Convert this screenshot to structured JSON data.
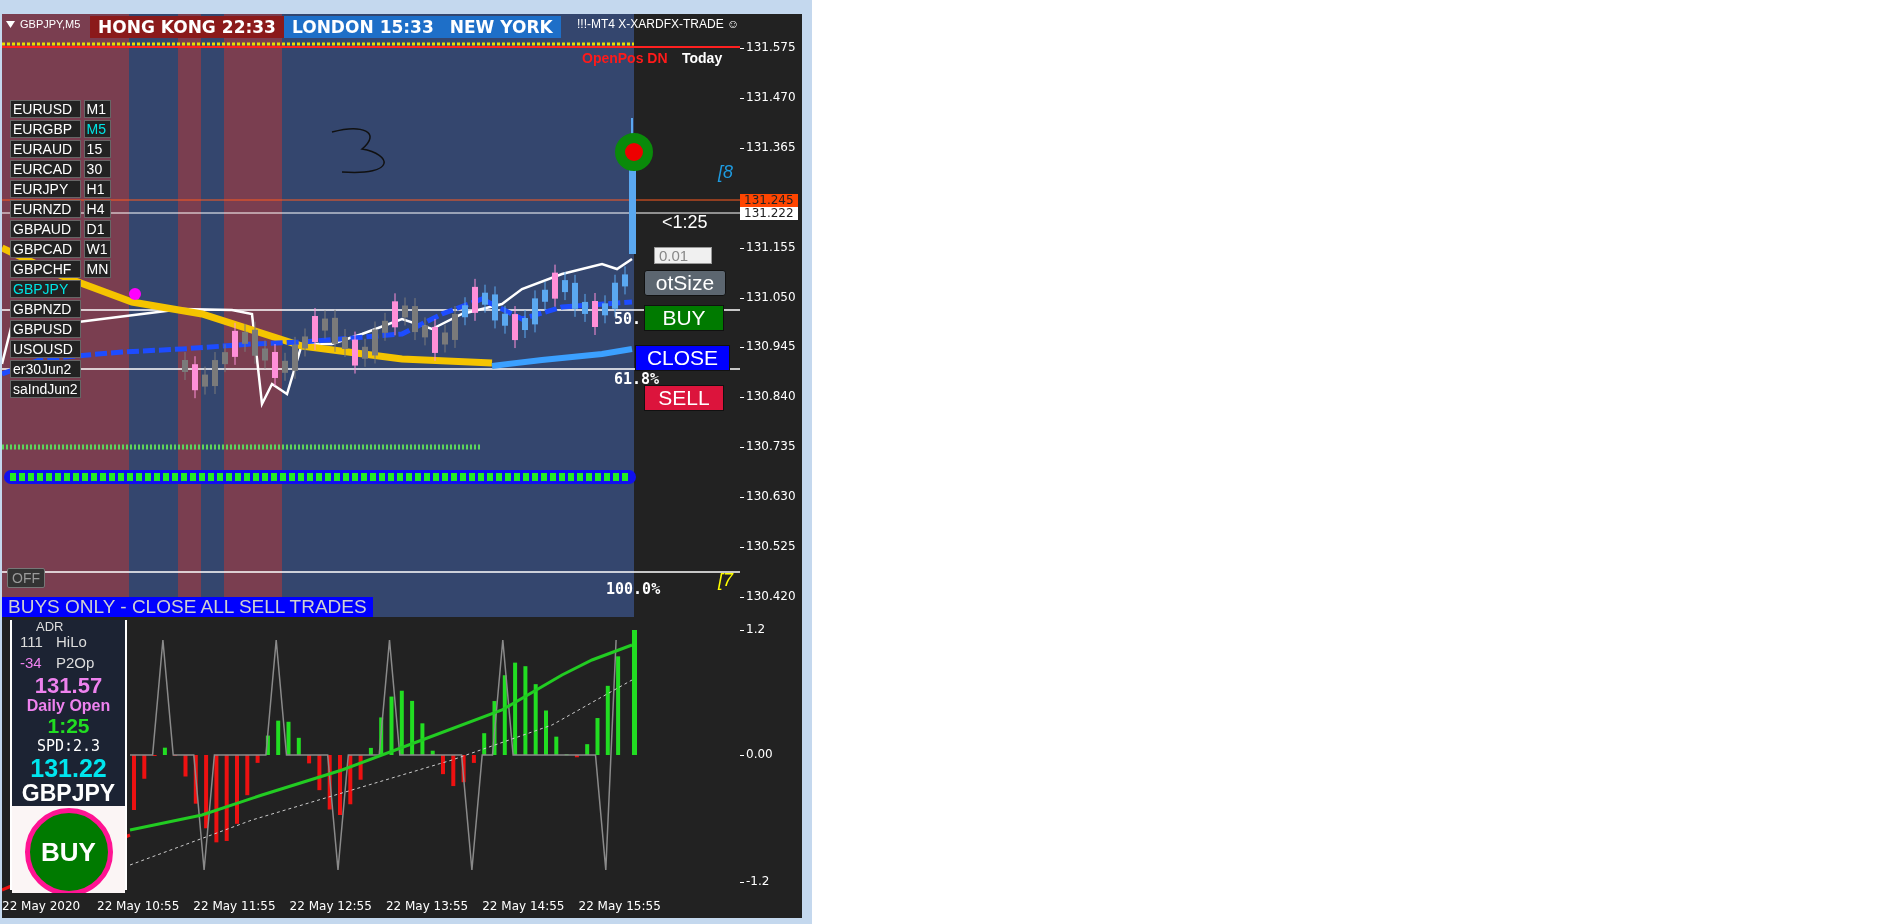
{
  "chart_tab": {
    "label": "GBPJPY,M5"
  },
  "sessions": [
    {
      "name": "HONG KONG",
      "time": "22:33",
      "color": "#8b1a1a"
    },
    {
      "name": "LONDON",
      "time": "15:33",
      "color": "#1e6fc8"
    },
    {
      "name": "NEW YORK",
      "color": "#1e6fc8"
    }
  ],
  "ea_title": "!!!-MT4 X-XARDFX-TRADE ☺",
  "open_pos_label": "OpenPos DN",
  "today_label": "Today",
  "symbols": [
    {
      "symbol": "EURUSD",
      "timeframe": "M1",
      "symbol_selected": false,
      "timeframe_selected": false
    },
    {
      "symbol": "EURGBP",
      "timeframe": "M5",
      "symbol_selected": false,
      "timeframe_selected": true
    },
    {
      "symbol": "EURAUD",
      "timeframe": "15",
      "symbol_selected": false,
      "timeframe_selected": false
    },
    {
      "symbol": "EURCAD",
      "timeframe": "30",
      "symbol_selected": false,
      "timeframe_selected": false
    },
    {
      "symbol": "EURJPY",
      "timeframe": "H1",
      "symbol_selected": false,
      "timeframe_selected": false
    },
    {
      "symbol": "EURNZD",
      "timeframe": "H4",
      "symbol_selected": false,
      "timeframe_selected": false
    },
    {
      "symbol": "GBPAUD",
      "timeframe": "D1",
      "symbol_selected": false,
      "timeframe_selected": false
    },
    {
      "symbol": "GBPCAD",
      "timeframe": "W1",
      "symbol_selected": false,
      "timeframe_selected": false
    },
    {
      "symbol": "GBPCHF",
      "timeframe": "MN",
      "symbol_selected": false,
      "timeframe_selected": false
    },
    {
      "symbol": "GBPJPY",
      "symbol_selected": true
    },
    {
      "symbol": "GBPNZD",
      "symbol_selected": false
    },
    {
      "symbol": "GBPUSD",
      "symbol_selected": false
    },
    {
      "symbol": "USOUSD",
      "symbol_selected": false
    },
    {
      "symbol": "er30Jun2",
      "symbol_selected": false
    },
    {
      "symbol": "saIndJun2",
      "symbol_selected": false
    }
  ],
  "trade_panel": {
    "countdown": "<1:25",
    "lot": "0.01",
    "lot_button": "otSize",
    "buy": "BUY",
    "close": "CLOSE",
    "sell": "SELL"
  },
  "fib_levels": [
    "50.",
    "61.8%",
    "100.0%"
  ],
  "bracket_labels": [
    "[8",
    "[7"
  ],
  "off_button": "OFF",
  "banner": "BUYS ONLY - CLOSE ALL SELL TRADES",
  "price_axis": {
    "ticks": [
      "131.575",
      "131.470",
      "131.365",
      "131.155",
      "131.050",
      "130.945",
      "130.840",
      "130.735",
      "130.630",
      "130.525",
      "130.420"
    ],
    "tags": [
      {
        "value": "131.245",
        "color": "#ff4500"
      },
      {
        "value": "131.222",
        "color": "#ffffff"
      }
    ]
  },
  "info_panel": {
    "adr_label": "ADR",
    "rows": [
      {
        "value": "111",
        "label": "HiLo",
        "color": "#dddddd"
      },
      {
        "value": "-34",
        "label": "P2Op",
        "color": "#ee82ee"
      }
    ],
    "daily_open": "131.57",
    "daily_open_label": "Daily Open",
    "timer": "1:25",
    "spread": "SPD:2.3",
    "bid": "131.22",
    "symbol": "GBPJPY",
    "signal": "BUY"
  },
  "indicator_axis": [
    "1.2",
    "0.00",
    "-1.2"
  ],
  "time_axis": [
    "22 May 2020",
    "22 May 10:55",
    "22 May 11:55",
    "22 May 12:55",
    "22 May 13:55",
    "22 May 14:55",
    "22 May 15:55"
  ]
}
